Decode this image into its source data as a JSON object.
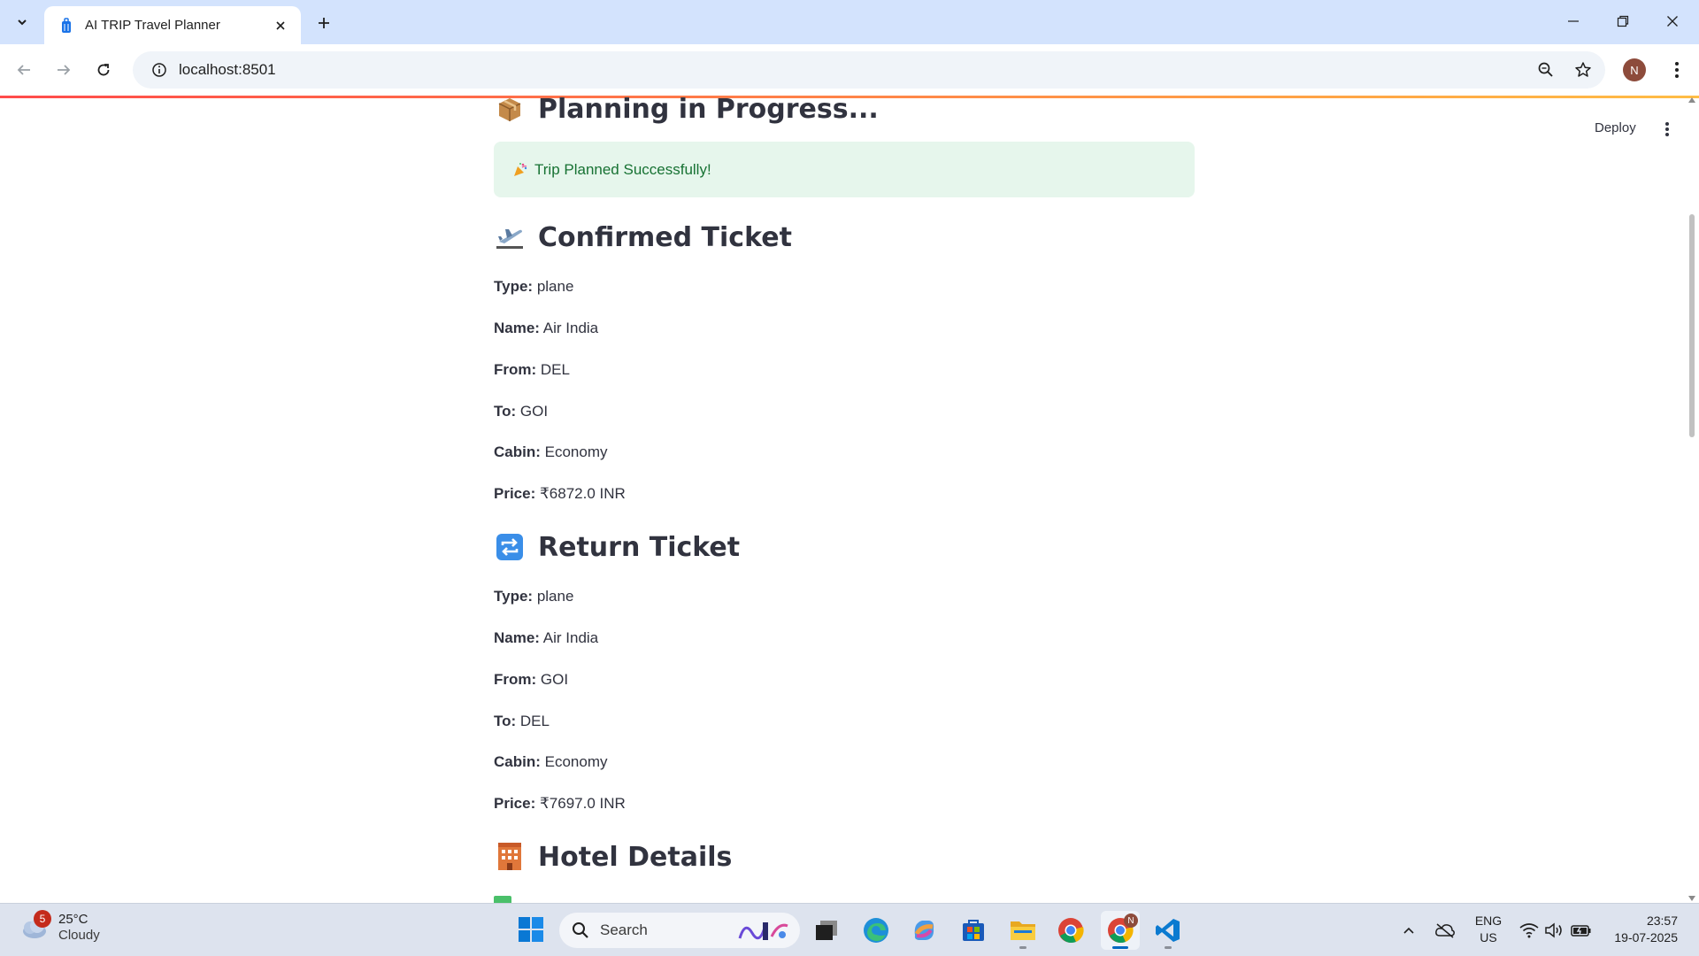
{
  "browser": {
    "tab_title": "AI TRIP Travel Planner",
    "url": "localhost:8501",
    "profile_initial": "N"
  },
  "app": {
    "deploy_label": "Deploy",
    "planning_heading": "Planning in Progress...",
    "success_message": "Trip Planned Successfully!",
    "confirmed": {
      "heading": "Confirmed Ticket",
      "fields": [
        {
          "label": "Type:",
          "value": "plane"
        },
        {
          "label": "Name:",
          "value": "Air India"
        },
        {
          "label": "From:",
          "value": "DEL"
        },
        {
          "label": "To:",
          "value": "GOI"
        },
        {
          "label": "Cabin:",
          "value": "Economy"
        },
        {
          "label": "Price:",
          "value": "₹6872.0 INR"
        }
      ]
    },
    "return": {
      "heading": "Return Ticket",
      "fields": [
        {
          "label": "Type:",
          "value": "plane"
        },
        {
          "label": "Name:",
          "value": "Air India"
        },
        {
          "label": "From:",
          "value": "GOI"
        },
        {
          "label": "To:",
          "value": "DEL"
        },
        {
          "label": "Cabin:",
          "value": "Economy"
        },
        {
          "label": "Price:",
          "value": "₹7697.0 INR"
        }
      ]
    },
    "hotel": {
      "heading": "Hotel Details"
    }
  },
  "taskbar": {
    "weather_badge": "5",
    "weather_temp": "25°C",
    "weather_condition": "Cloudy",
    "search_label": "Search",
    "lang_top": "ENG",
    "lang_bottom": "US",
    "time": "23:57",
    "date": "19-07-2025",
    "chrome_badge": "N"
  },
  "colors": {
    "tabstrip": "#d3e3fd",
    "success_bg": "#e6f6ec",
    "success_text": "#177233",
    "text": "#31333f",
    "accent": "#ff4b4b"
  }
}
